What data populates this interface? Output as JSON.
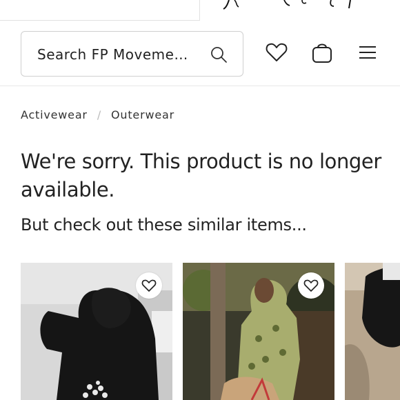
{
  "header": {
    "search": {
      "placeholder": "Search FP Moveme…"
    },
    "icons": [
      "wishlist-icon",
      "bag-icon",
      "menu-icon",
      "search-icon"
    ]
  },
  "breadcrumb": {
    "items": [
      "Activewear",
      "Outerwear"
    ],
    "separator": "/"
  },
  "message": {
    "headline": "We're sorry. This product is no longer available.",
    "subhead": "But check out these similar items..."
  },
  "products": [
    {
      "image": "black-hoodie-back-view"
    },
    {
      "image": "green-printed-hoodie"
    },
    {
      "image": "black-hoodie-partial"
    }
  ],
  "colors": {
    "text": "#222222",
    "border": "#cfcfcf",
    "divider": "#e8e8e8"
  }
}
